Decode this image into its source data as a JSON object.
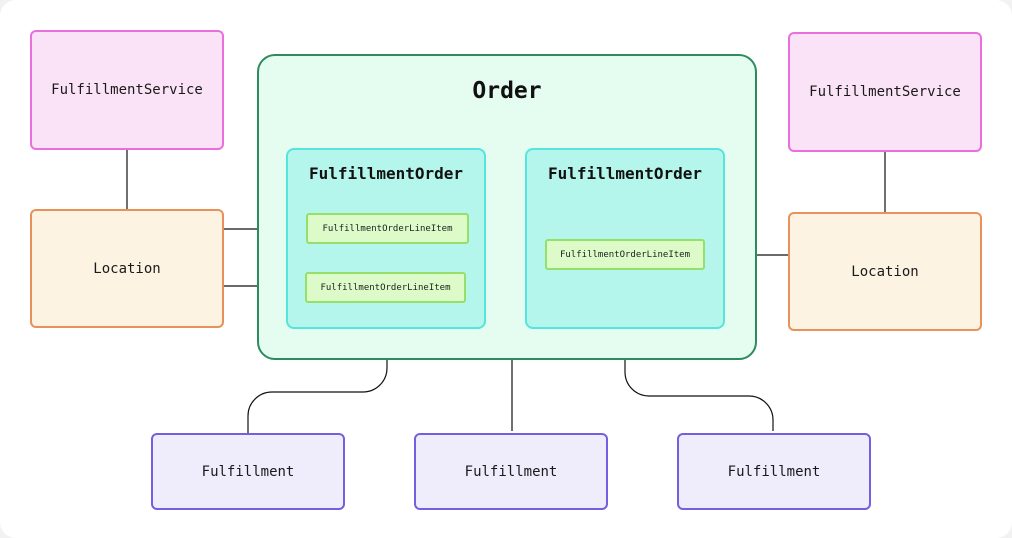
{
  "diagram": {
    "order": {
      "label": "Order"
    },
    "fulfillment_orders": [
      {
        "label": "FulfillmentOrder",
        "line_items": [
          "FulfillmentOrderLineItem",
          "FulfillmentOrderLineItem"
        ]
      },
      {
        "label": "FulfillmentOrder",
        "line_items": [
          "FulfillmentOrderLineItem"
        ]
      }
    ],
    "fulfillment_services": [
      {
        "label": "FulfillmentService"
      },
      {
        "label": "FulfillmentService"
      }
    ],
    "locations": [
      {
        "label": "Location"
      },
      {
        "label": "Location"
      }
    ],
    "fulfillments": [
      {
        "label": "Fulfillment"
      },
      {
        "label": "Fulfillment"
      },
      {
        "label": "Fulfillment"
      }
    ],
    "edges": [
      {
        "from": "fulfillment_services.0",
        "to": "locations.0"
      },
      {
        "from": "fulfillment_services.1",
        "to": "locations.1"
      },
      {
        "from": "locations.0",
        "to": "fulfillment_orders.0.line_items.0"
      },
      {
        "from": "locations.0",
        "to": "fulfillment_orders.0.line_items.1"
      },
      {
        "from": "locations.1",
        "to": "fulfillment_orders.1.line_items.0"
      },
      {
        "from": "fulfillment_orders.0.line_items.0",
        "to": "fulfillments.1"
      },
      {
        "from": "fulfillment_orders.0.line_items.1",
        "to": "fulfillments.0"
      },
      {
        "from": "fulfillment_orders.1.line_items.0",
        "to": "fulfillments.2"
      }
    ],
    "colors": {
      "fulfillment_service_fill": "#fae3f6",
      "fulfillment_service_stroke": "#ea6fdc",
      "location_fill": "#fdf3e3",
      "location_stroke": "#e8915a",
      "order_fill": "#e5fcf0",
      "order_stroke": "#2e8b5c",
      "fulfillment_order_fill": "#b4f6eb",
      "fulfillment_order_stroke": "#55e5dc",
      "line_item_fill": "#dcfbc8",
      "line_item_stroke": "#94e06a",
      "fulfillment_fill": "#efecfb",
      "fulfillment_stroke": "#7260e0"
    }
  }
}
